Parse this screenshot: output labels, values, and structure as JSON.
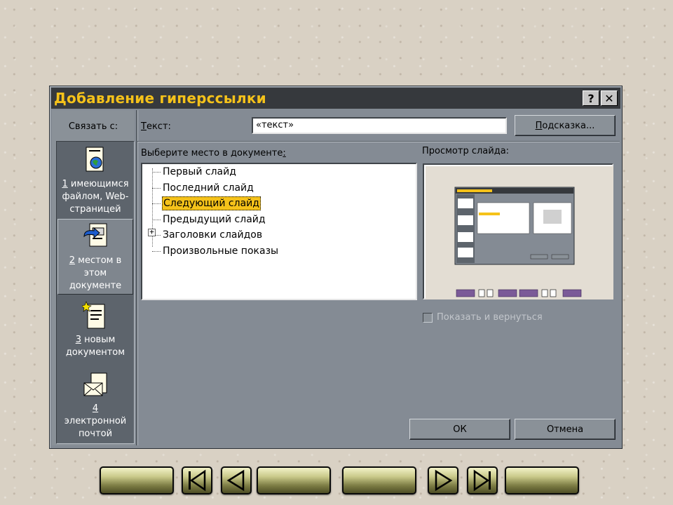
{
  "dialog": {
    "title": "Добавление гиперссылки",
    "help_label": "?",
    "close_label": "✕"
  },
  "sidebar": {
    "label": "Связать с:",
    "items": [
      {
        "accel": "1",
        "label": " имеющимся файлом, Web-страницей",
        "icon": "web-file-icon"
      },
      {
        "accel": "2",
        "label": " местом в этом документе",
        "icon": "place-in-document-icon"
      },
      {
        "accel": "3",
        "label": " новым документом",
        "icon": "new-document-icon"
      },
      {
        "accel": "4",
        "label": "электронной почтой",
        "icon": "email-icon"
      }
    ],
    "selected_index": 1
  },
  "text_field": {
    "label_accel": "Т",
    "label_rest": "екст:",
    "value": "«текст»"
  },
  "tooltip_button": {
    "accel": "П",
    "rest": "одсказка..."
  },
  "place": {
    "label": "Выберите место в документе",
    "label_suffix": ":",
    "items": [
      {
        "label": "Первый слайд"
      },
      {
        "label": "Последний слайд"
      },
      {
        "label": "Следующий слайд"
      },
      {
        "label": "Предыдущий слайд"
      },
      {
        "label": "Заголовки слайдов"
      },
      {
        "label": "Произвольные показы"
      }
    ],
    "selected_index": 2
  },
  "preview": {
    "label": "Просмотр слайда:"
  },
  "show_and_return": {
    "label": "Показать и вернуться",
    "checked": false,
    "enabled": false
  },
  "buttons": {
    "ok": "ОК",
    "cancel": "Отмена"
  },
  "nav": {
    "buttons": [
      {
        "icon": "blank-icon"
      },
      {
        "icon": "first-slide-icon"
      },
      {
        "icon": "previous-slide-icon"
      },
      {
        "icon": "blank-icon"
      },
      {
        "icon": "blank-icon"
      },
      {
        "icon": "next-slide-icon"
      },
      {
        "icon": "last-slide-icon"
      },
      {
        "icon": "blank-icon"
      }
    ]
  },
  "colors": {
    "title_text": "#f5c21a",
    "selection": "#f5c21a",
    "dialog_bg": "#848b94",
    "title_bg": "#36393d"
  }
}
